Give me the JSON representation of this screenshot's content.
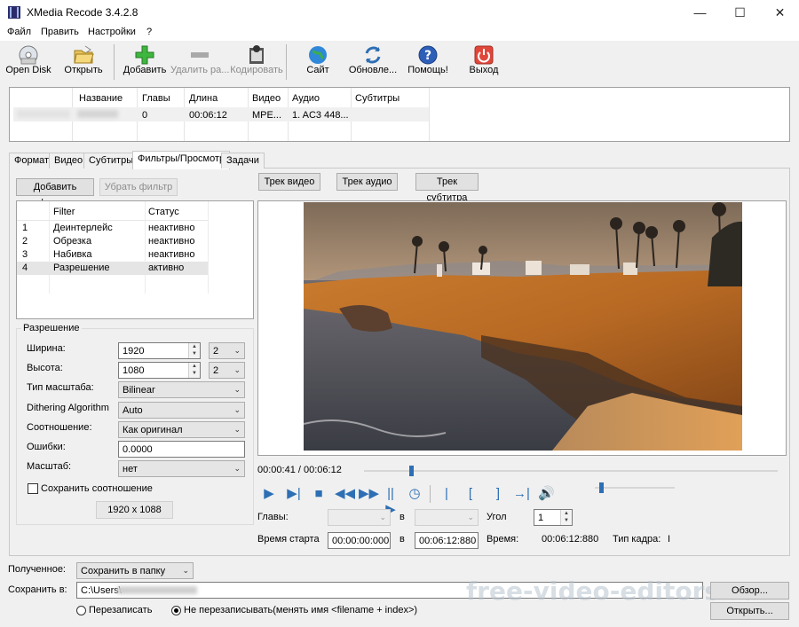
{
  "window": {
    "title": "XMedia Recode 3.4.2.8",
    "minimize": "—",
    "maximize": "☐",
    "close": "✕"
  },
  "menu": [
    "Файл",
    "Править",
    "Настройки",
    "?"
  ],
  "toolbar": [
    {
      "label": "Open Disk",
      "icon": "disc-icon",
      "enabled": true
    },
    {
      "label": "Открыть",
      "icon": "folder-open-icon",
      "enabled": true
    },
    {
      "label": "Добавить",
      "icon": "plus-icon",
      "enabled": true
    },
    {
      "label": "Удалить ра...",
      "icon": "minus-icon",
      "enabled": false
    },
    {
      "label": "Кодировать",
      "icon": "film-encode-icon",
      "enabled": false
    },
    {
      "label": "Сайт",
      "icon": "globe-icon",
      "enabled": true
    },
    {
      "label": "Обновле...",
      "icon": "refresh-icon",
      "enabled": true
    },
    {
      "label": "Помощь!",
      "icon": "help-icon",
      "enabled": true
    },
    {
      "label": "Выход",
      "icon": "power-icon",
      "enabled": true
    }
  ],
  "file_list": {
    "headers": [
      "Название",
      "Главы",
      "Длина",
      "Видео",
      "Аудио",
      "Субтитры"
    ],
    "row": {
      "name": "",
      "chapters": "0",
      "length": "00:06:12",
      "video": "MPE...",
      "audio": "1. AC3 448...",
      "subtitles": ""
    }
  },
  "tabs": [
    "Формат",
    "Видео",
    "Субтитры",
    "Фильтры/Просмотр",
    "Задачи"
  ],
  "active_tab": "Фильтры/Просмотр",
  "filters": {
    "add_button": "Добавить фильтр",
    "remove_button": "Убрать фильтр",
    "headers": [
      "Filter",
      "Статус"
    ],
    "rows": [
      {
        "n": "1",
        "filter": "Деинтерлейс",
        "status": "неактивно"
      },
      {
        "n": "2",
        "filter": "Обрезка",
        "status": "неактивно"
      },
      {
        "n": "3",
        "filter": "Набивка",
        "status": "неактивно"
      },
      {
        "n": "4",
        "filter": "Разрешение",
        "status": "активно"
      }
    ]
  },
  "resolution": {
    "group_title": "Разрешение",
    "width_label": "Ширина:",
    "width": "1920",
    "width_step": "2",
    "height_label": "Высота:",
    "height": "1080",
    "height_step": "2",
    "scale_type_label": "Тип масштаба:",
    "scale_type": "Bilinear",
    "dithering_label": "Dithering Algorithm",
    "dithering": "Auto",
    "ratio_label": "Соотношение:",
    "ratio": "Как оригинал",
    "errors_label": "Ошибки:",
    "errors": "0.0000",
    "scale_label": "Масштаб:",
    "scale": "нет",
    "keep_ratio_label": "Сохранить соотношение",
    "keep_ratio_checked": false,
    "size_display": "1920 x 1088"
  },
  "preview": {
    "track_video": "Трек видео",
    "track_audio": "Трек аудио",
    "track_subtitle": "Трек субтитра",
    "time": "00:00:41 / 00:06:12",
    "progress": 0.11,
    "volume": 0.06
  },
  "playback": {
    "chapters_label": "Главы:",
    "in_label": "в",
    "angle_label": "Угол",
    "angle": "1",
    "start_label": "Время старта",
    "start": "00:00:00:000",
    "in_label2": "в",
    "end": "00:06:12:880",
    "time_label": "Время:",
    "time": "00:06:12:880",
    "frame_type_label": "Тип кадра:",
    "frame_type": "I"
  },
  "output": {
    "received_label": "Полученное:",
    "received": "Сохранить в папку",
    "save_to_label": "Сохранить в:",
    "path": "C:\\Users\\",
    "browse_button": "Обзор...",
    "open_button": "Открыть...",
    "overwrite_label": "Перезаписать",
    "no_overwrite_label": "Не перезаписывать(менять имя <filename + index>)",
    "selected": "no_overwrite"
  },
  "watermark": "free-video-editors.ru",
  "colors": {
    "accent": "#2d6fb4",
    "selection": "#e5e5e5",
    "window_bg": "#f0f0f0"
  }
}
